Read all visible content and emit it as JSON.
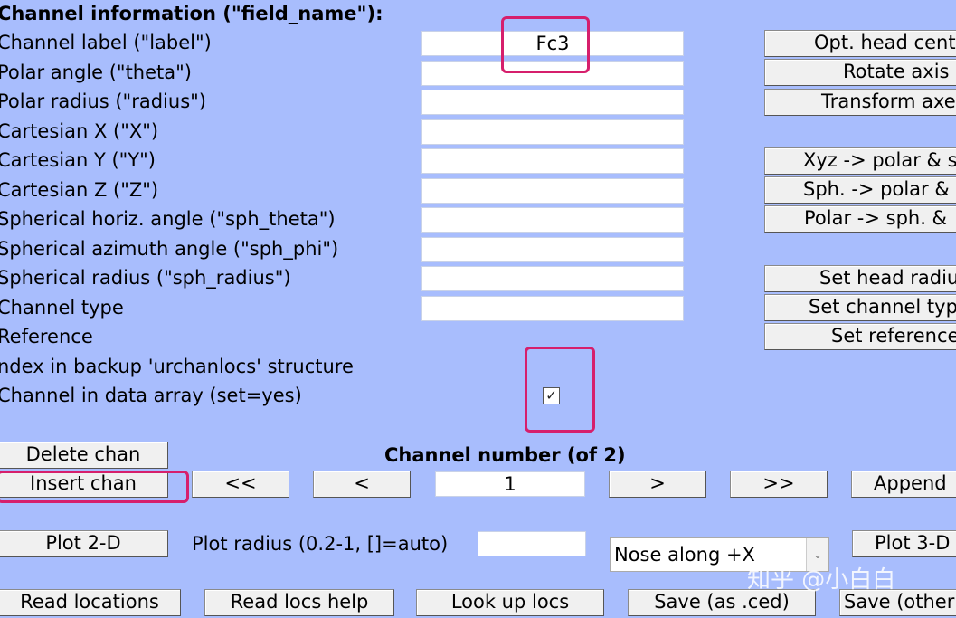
{
  "header": "Channel information (\"field_name\"):",
  "fields": [
    {
      "label": "Channel label (\"label\")",
      "value": "Fc3"
    },
    {
      "label": "Polar angle (\"theta\")",
      "value": ""
    },
    {
      "label": "Polar radius (\"radius\")",
      "value": ""
    },
    {
      "label": "Cartesian X (\"X\")",
      "value": ""
    },
    {
      "label": "Cartesian Y (\"Y\")",
      "value": ""
    },
    {
      "label": "Cartesian Z (\"Z\")",
      "value": ""
    },
    {
      "label": "Spherical horiz. angle (\"sph_theta\")",
      "value": ""
    },
    {
      "label": "Spherical azimuth angle (\"sph_phi\")",
      "value": ""
    },
    {
      "label": "Spherical radius (\"sph_radius\")",
      "value": ""
    },
    {
      "label": "Channel type",
      "value": ""
    }
  ],
  "extra_labels": {
    "reference": "Reference",
    "index_backup": "ndex in backup 'urchanlocs' structure",
    "in_data_array": "Channel in data array (set=yes)"
  },
  "checkbox": {
    "checked": true,
    "glyph": "✓"
  },
  "side_buttons": {
    "opt_head_center": "Opt. head cent",
    "rotate_axis": "Rotate axis",
    "transform_axes": "Transform axe",
    "xyz_polar": "Xyz -> polar & s",
    "sph_polar": "Sph. -> polar &",
    "polar_sph": "Polar -> sph. &",
    "set_head_radius": "Set head radiu",
    "set_channel_type": "Set channel typ",
    "set_reference": "Set reference"
  },
  "nav": {
    "delete_chan": "Delete chan",
    "insert_chan": "Insert chan",
    "channel_number_title": "Channel number (of 2)",
    "first": "<<",
    "prev": "<",
    "current": "1",
    "next": ">",
    "last": ">>",
    "append": "Append"
  },
  "plot": {
    "plot_2d": "Plot 2-D",
    "radius_label": "Plot radius (0.2-1, []=auto)",
    "radius_value": "",
    "nose_selected": "Nose along +X",
    "plot_3d": "Plot 3-D"
  },
  "bottom": {
    "read_locations": "Read locations",
    "read_locs_help": "Read locs help",
    "look_up_locs": "Look up locs",
    "save_ced": "Save (as .ced)",
    "save_other": "Save (other"
  },
  "watermark": "知乎 @小白白",
  "colors": {
    "background": "#a8bdfd",
    "highlight": "#d61f6c"
  }
}
